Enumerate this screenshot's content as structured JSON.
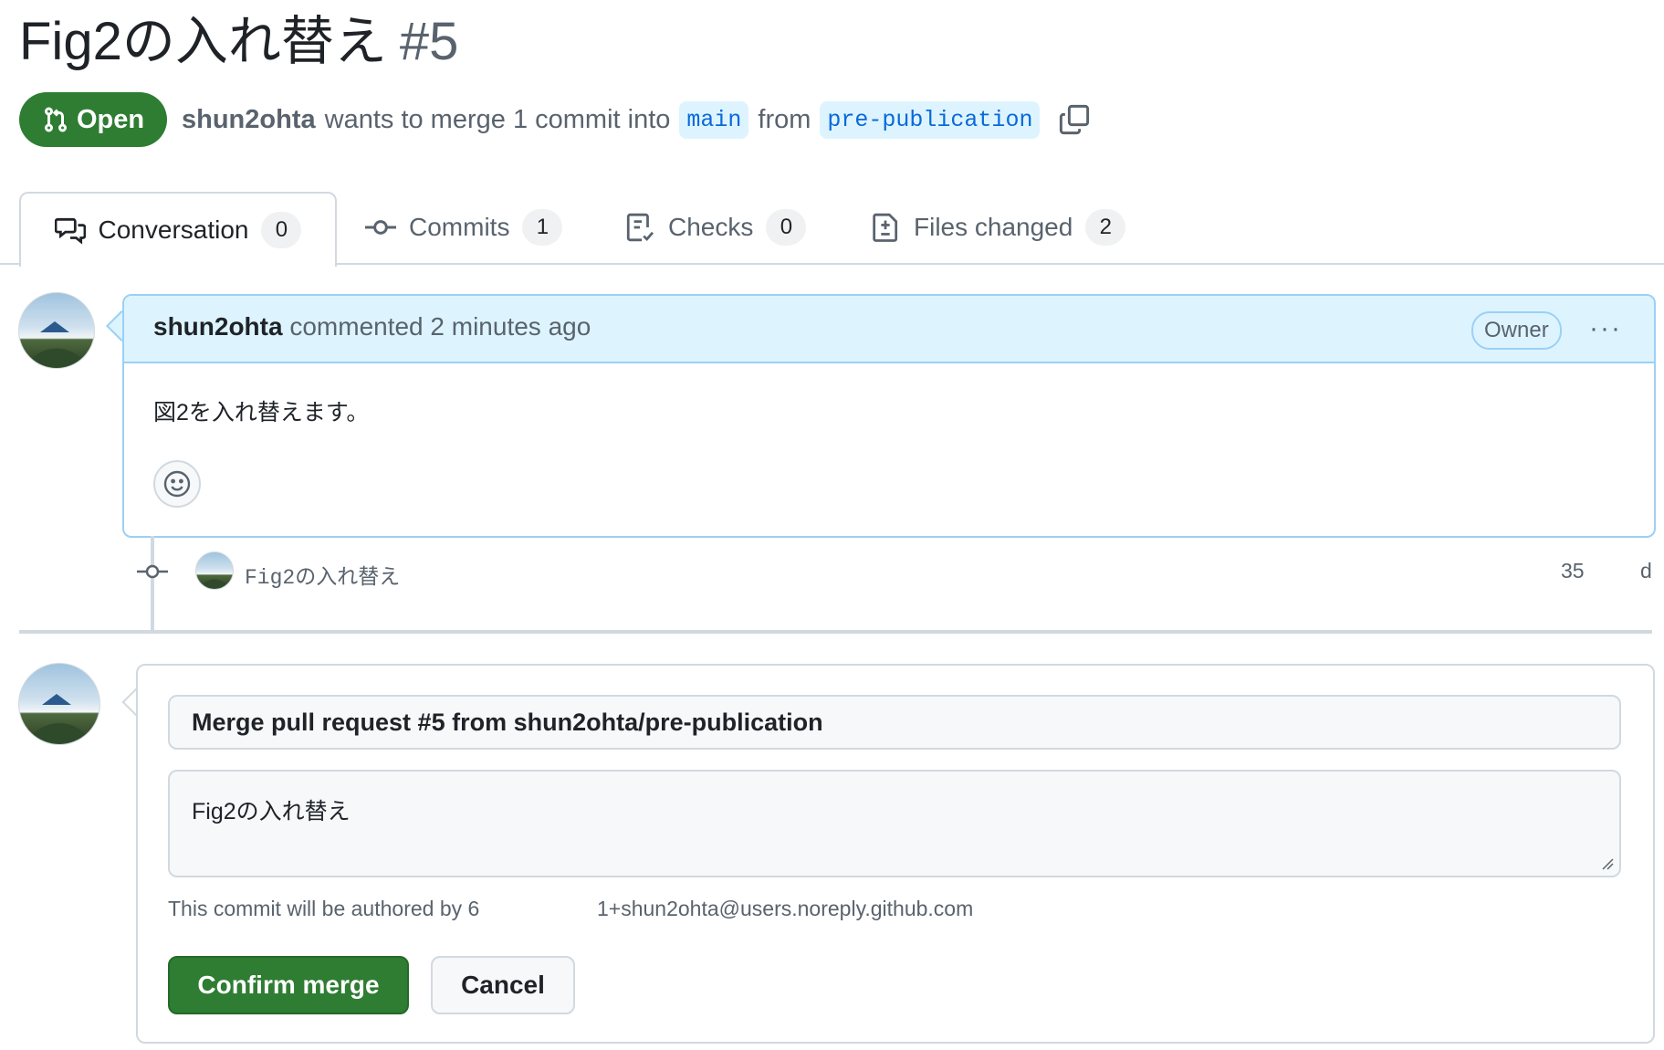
{
  "pr": {
    "title": "Fig2の入れ替え",
    "number": "#5",
    "state": "Open",
    "author": "shun2ohta",
    "merge_text": "wants to merge 1 commit into",
    "base_branch": "main",
    "from_text": "from",
    "head_branch": "pre-publication"
  },
  "tabs": [
    {
      "label": "Conversation",
      "count": "0",
      "icon": "comment-discussion-icon"
    },
    {
      "label": "Commits",
      "count": "1",
      "icon": "git-commit-icon"
    },
    {
      "label": "Checks",
      "count": "0",
      "icon": "checklist-icon"
    },
    {
      "label": "Files changed",
      "count": "2",
      "icon": "file-diff-icon"
    }
  ],
  "comment": {
    "author": "shun2ohta",
    "action": "commented 2 minutes ago",
    "role_badge": "Owner",
    "menu": "···",
    "body": "図2を入れ替えます。"
  },
  "commit": {
    "message": "Fig2の入れ替え",
    "sha_part1": "35",
    "sha_part2": "d"
  },
  "merge": {
    "commit_title": "Merge pull request #5 from shun2ohta/pre-publication",
    "commit_message": "Fig2の入れ替え",
    "author_note": "This commit will be authored by 6",
    "author_email": "1+shun2ohta@users.noreply.github.com",
    "confirm_label": "Confirm merge",
    "cancel_label": "Cancel"
  },
  "colors": {
    "open_green": "#2e7d32",
    "branch_blue": "#0969da",
    "comment_header": "#ddf4ff"
  }
}
